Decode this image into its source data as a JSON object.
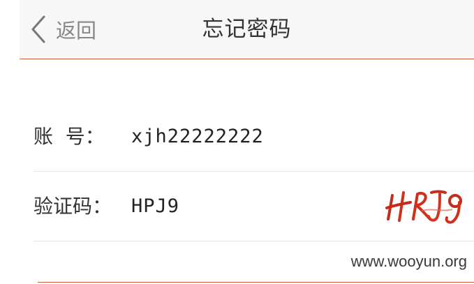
{
  "header": {
    "back_label": "返回",
    "title": "忘记密码",
    "accent_color": "#c0643a"
  },
  "form": {
    "account": {
      "label": "账  号：",
      "value": "xjh22222222"
    },
    "captcha": {
      "label": "验证码：",
      "value": "HPJ9",
      "image_text": "HPJ9"
    }
  },
  "watermark": "www.wooyun.org"
}
